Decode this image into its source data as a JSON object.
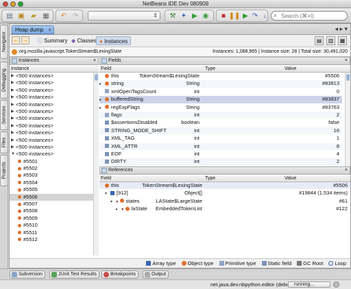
{
  "window": {
    "title": "NetBeans IDE Dev 080909"
  },
  "search": {
    "placeholder": "Search (⌘+I)"
  },
  "left_tabs": [
    "Navigator",
    "Debugging",
    "Services",
    "Files",
    "Projects"
  ],
  "doc_tab": {
    "label": "Heap dump"
  },
  "heap_tabs": [
    "Summary",
    "Classes",
    "Instances"
  ],
  "class_bar": {
    "name": "org.mozilla.javascript.TokenStream$LexingState",
    "stats": "Instances: 1,088,965  |  Instance size: 28  |  Total size: 30,491,020"
  },
  "instances_pane": {
    "title": "Instances",
    "column": "Instance",
    "groups": [
      "<500 instances>",
      "<500 instances>",
      "<500 instances>",
      "<500 instances>",
      "<500 instances>",
      "<500 instances>",
      "<500 instances>",
      "<500 instances>",
      "<500 instances>",
      "<500 instances>",
      "<500 instances>",
      "<500 instances>"
    ],
    "items": [
      "#5501",
      "#5502",
      "#5503",
      "#5504",
      "#5505",
      "#5506",
      "#5507",
      "#5508",
      "#5509",
      "#5510",
      "#5511",
      "#5512"
    ],
    "selected_item": "#5506"
  },
  "fields_pane": {
    "title": "Fields",
    "columns": [
      "Field",
      "Type",
      "Value"
    ],
    "rows": [
      {
        "field": "this",
        "type": "TokenStream$LexingState",
        "value": "#5506",
        "kind": "obj",
        "tw": ""
      },
      {
        "field": "string",
        "type": "String",
        "value": "#83813",
        "kind": "obj",
        "tw": "▸"
      },
      {
        "field": "xmlOpenTagsCount",
        "type": "int",
        "value": "0",
        "kind": "prim",
        "tw": ""
      },
      {
        "field": "bufferedString",
        "type": "String",
        "value": "#83837",
        "kind": "obj",
        "tw": "▸"
      },
      {
        "field": "regExpFlags",
        "type": "String",
        "value": "#83763",
        "kind": "obj",
        "tw": "▸"
      },
      {
        "field": "flags",
        "type": "int",
        "value": "2",
        "kind": "prim",
        "tw": ""
      },
      {
        "field": "$assertionsDisabled",
        "type": "boolean",
        "value": "false",
        "kind": "st",
        "tw": ""
      },
      {
        "field": "STRING_MODE_SHIFT",
        "type": "int",
        "value": "16",
        "kind": "st",
        "tw": ""
      },
      {
        "field": "XML_TAG",
        "type": "int",
        "value": "1",
        "kind": "st",
        "tw": ""
      },
      {
        "field": "XML_ATTR",
        "type": "int",
        "value": "8",
        "kind": "st",
        "tw": ""
      },
      {
        "field": "EOF",
        "type": "int",
        "value": "4",
        "kind": "st",
        "tw": ""
      },
      {
        "field": "DIRTY",
        "type": "int",
        "value": "2",
        "kind": "st",
        "tw": ""
      }
    ]
  },
  "references_pane": {
    "title": "References",
    "columns": [
      "Field",
      "Type",
      "Value"
    ],
    "rows": [
      {
        "field": "this",
        "type": "TokenStream$LexingState",
        "value": "#5506",
        "indent": 0,
        "tw": ""
      },
      {
        "field": "[912]",
        "type": "Object[]",
        "value": "#19844 (1,534 items)",
        "indent": 1,
        "tw": "▾"
      },
      {
        "field": "states",
        "type": "LAState$LargeState",
        "value": "#61",
        "indent": 2,
        "tw": "▾"
      },
      {
        "field": "laState",
        "type": "EmbeddedTokenList",
        "value": "#122",
        "indent": 3,
        "tw": "▸"
      }
    ]
  },
  "legend": {
    "items": [
      "Array type",
      "Object type",
      "Primitive type",
      "Static field",
      "GC Root",
      "Loop"
    ]
  },
  "bottom_tabs": [
    "Subversion",
    "JUnit Test Results",
    "Breakpoints",
    "Output"
  ],
  "status": {
    "project": "net.java.dev.nbpython.editor (debug)",
    "progress": "running..."
  }
}
